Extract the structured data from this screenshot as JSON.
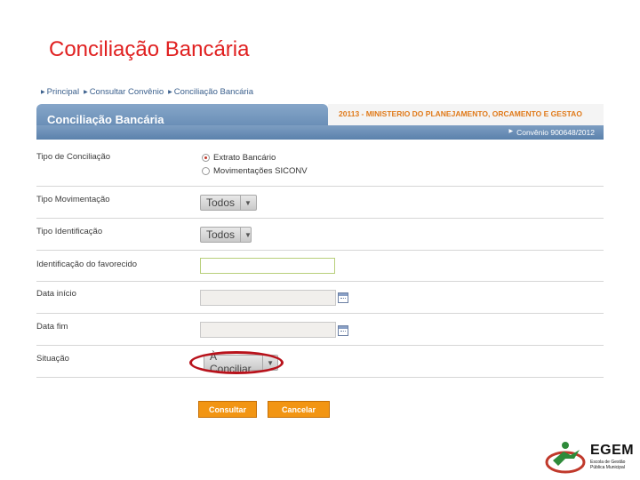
{
  "slide": {
    "title": "Conciliação Bancária"
  },
  "breadcrumb": [
    "Principal",
    "Consultar Convênio",
    "Conciliação Bancária"
  ],
  "header": {
    "tab_title": "Conciliação Bancária",
    "ministry": "20113 - MINISTERIO DO PLANEJAMENTO, ORCAMENTO E GESTAO",
    "convenio": "Convênio 900648/2012"
  },
  "form": {
    "tipo_conciliacao": {
      "label": "Tipo de Conciliação",
      "options": [
        {
          "label": "Extrato Bancário",
          "checked": true
        },
        {
          "label": "Movimentações SICONV",
          "checked": false
        }
      ]
    },
    "tipo_movimentacao": {
      "label": "Tipo Movimentação",
      "value": "Todos"
    },
    "tipo_identificacao": {
      "label": "Tipo Identificação",
      "value": "Todos"
    },
    "identificacao_favorecido": {
      "label": "Identificação do favorecido",
      "value": ""
    },
    "data_inicio": {
      "label": "Data início",
      "value": ""
    },
    "data_fim": {
      "label": "Data fim",
      "value": ""
    },
    "situacao": {
      "label": "Situação",
      "value": "À Conciliar"
    }
  },
  "buttons": {
    "consultar": "Consultar",
    "cancelar": "Cancelar"
  },
  "logo": {
    "name": "EGEM",
    "subtitle": "Escola de Gestão Pública Municipal"
  },
  "colors": {
    "title": "#e02020",
    "header": "#6b8fb8",
    "accent": "#f29513",
    "highlight": "#b8121b"
  },
  "icons": {
    "calendar": "calendar-icon",
    "breadcrumb_arrow": "triangle-right-icon"
  }
}
